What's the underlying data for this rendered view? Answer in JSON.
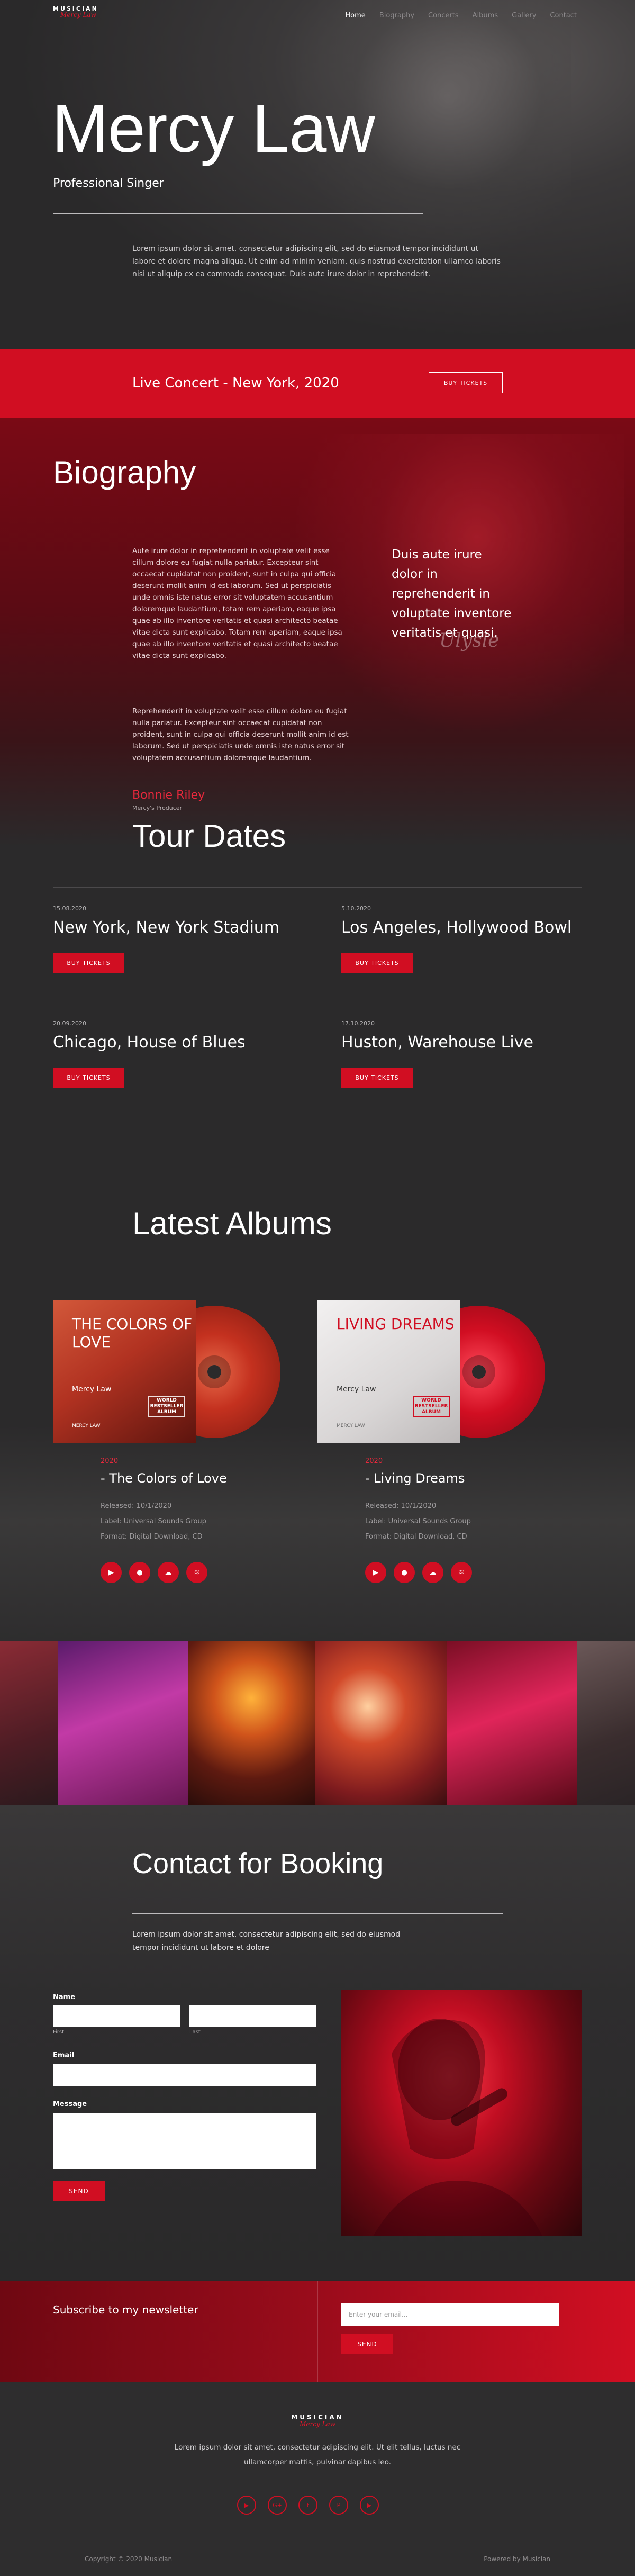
{
  "brand": {
    "name": "MUSICIAN",
    "script": "Mercy Law"
  },
  "nav": {
    "items": [
      "Home",
      "Biography",
      "Concerts",
      "Albums",
      "Gallery",
      "Contact"
    ],
    "active": "Home"
  },
  "hero": {
    "title": "Mercy Law",
    "subtitle": "Professional Singer",
    "text": "Lorem ipsum dolor sit amet, consectetur adipiscing elit, sed do eiusmod tempor incididunt ut labore et dolore magna aliqua. Ut enim ad minim veniam, quis nostrud exercitation ullamco laboris nisi ut aliquip ex ea commodo consequat. Duis aute irure dolor in reprehenderit."
  },
  "concert": {
    "title": "Live Concert - New York, 2020",
    "button": "BUY TICKETS"
  },
  "bio": {
    "title": "Biography",
    "p1": "Aute irure dolor in reprehenderit in voluptate velit esse cillum dolore eu fugiat nulla pariatur. Excepteur sint occaecat cupidatat non proident, sunt in culpa qui officia deserunt mollit anim id est laborum. Sed ut perspiciatis unde omnis iste natus error sit voluptatem accusantium doloremque laudantium, totam rem aperiam, eaque ipsa quae ab illo inventore veritatis et quasi architecto beatae vitae dicta sunt explicabo. Totam rem aperiam, eaque ipsa quae ab illo inventore veritatis et quasi architecto beatae vitae dicta sunt explicabo.",
    "p2": "Reprehenderit in voluptate velit esse cillum dolore eu fugiat nulla pariatur. Excepteur sint occaecat cupidatat non proident, sunt in culpa qui officia deserunt mollit anim id est laborum. Sed ut perspiciatis unde omnis iste natus error sit voluptatem accusantium doloremque laudantium.",
    "quote": "Duis aute irure dolor in reprehenderit in voluptate inventore veritatis et quasi.",
    "author": "Bonnie Riley",
    "role": "Mercy's Producer"
  },
  "tour": {
    "title": "Tour Dates",
    "items": [
      {
        "date": "15.08.2020",
        "city": "New York, New York Stadium",
        "button": "BUY TICKETS"
      },
      {
        "date": "5.10.2020",
        "city": "Los Angeles, Hollywood Bowl",
        "button": "BUY TICKETS"
      },
      {
        "date": "20.09.2020",
        "city": "Chicago, House of Blues",
        "button": "BUY TICKETS"
      },
      {
        "date": "17.10.2020",
        "city": "Huston, Warehouse Live",
        "button": "BUY TICKETS"
      }
    ]
  },
  "albums": {
    "title": "Latest Albums",
    "items": [
      {
        "cover_title": "THE COLORS OF LOVE",
        "cover_artist": "Mercy Law",
        "stamp": "WORLD BESTSELLER ALBUM",
        "cover_foot": "MERCY LAW",
        "year": "2020",
        "name": "- The Colors of Love",
        "released": "Released: 10/1/2020",
        "label": "Label: Universal Sounds Group",
        "format": "Format: Digital Download, CD",
        "cover_color": "#b13221",
        "cd_color": "#c4311f"
      },
      {
        "cover_title": "LIVING DREAMS",
        "cover_artist": "Mercy Law",
        "stamp": "WORLD BESTSELLER ALBUM",
        "cover_foot": "MERCY LAW",
        "year": "2020",
        "name": "- Living Dreams",
        "released": "Released: 10/1/2020",
        "label": "Label: Universal Sounds Group",
        "format": "Format: Digital Download, CD",
        "cover_color": "#e8e6e6",
        "cd_color": "#d10e22"
      }
    ],
    "icons": [
      "play-icon",
      "apple-icon",
      "soundcloud-icon",
      "spotify-icon"
    ]
  },
  "contact": {
    "title": "Contact for Booking",
    "text": "Lorem ipsum dolor sit amet, consectetur adipiscing elit, sed do eiusmod tempor incididunt ut labore et dolore",
    "name_label": "Name",
    "first_label": "First",
    "last_label": "Last",
    "email_label": "Email",
    "message_label": "Message",
    "send": "SEND"
  },
  "newsletter": {
    "title": "Subscribe to my newsletter",
    "placeholder": "Enter your email...",
    "button": "SEND"
  },
  "footer": {
    "text": "Lorem ipsum dolor sit amet, consectetur adipiscing elit. Ut elit tellus, luctus nec ullamcorper mattis, pulvinar dapibus leo.",
    "social": [
      "youtube-icon",
      "google-plus-icon",
      "twitter-icon",
      "pinterest-icon",
      "youtube-icon"
    ],
    "copyright": "Copyright © 2020 Musician",
    "powered": "Powered by Musician"
  },
  "colors": {
    "accent": "#d10e22",
    "dark": "#2b2a2b"
  }
}
